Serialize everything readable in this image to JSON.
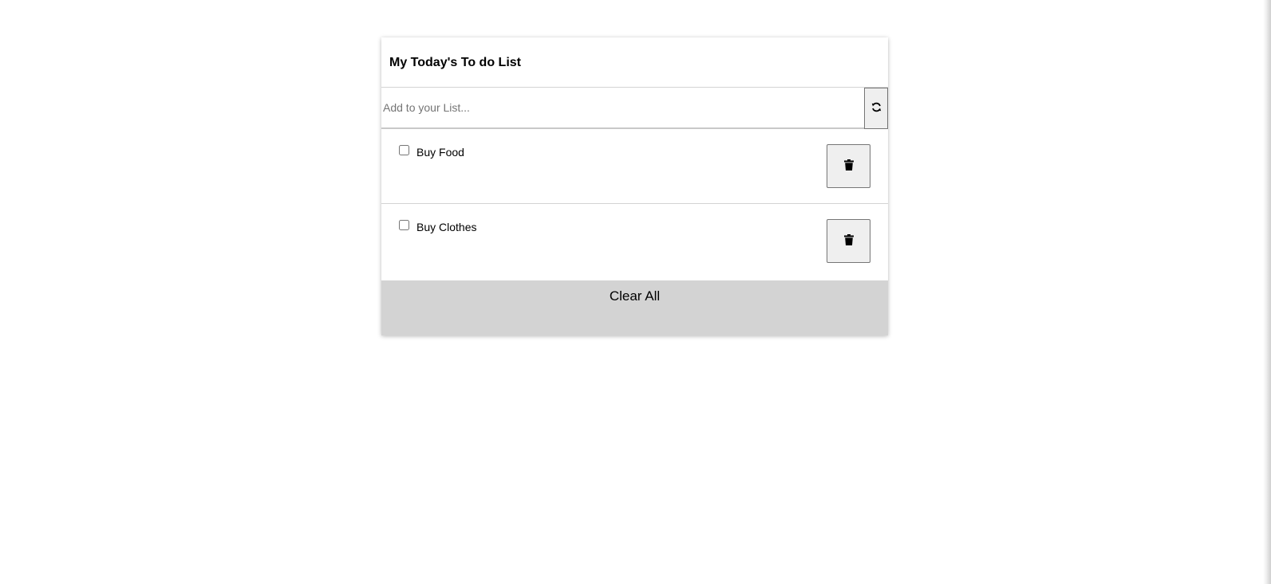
{
  "todo": {
    "title": "My Today's To do List",
    "input": {
      "value": "",
      "placeholder": "Add to your List..."
    },
    "refresh_icon": "refresh-icon",
    "items": [
      {
        "label": "Buy Food",
        "checked": false,
        "delete_icon": "trash-icon"
      },
      {
        "label": "Buy Clothes",
        "checked": false,
        "delete_icon": "trash-icon"
      }
    ],
    "clear_all_label": "Clear All"
  },
  "colors": {
    "clear_bar": "#d3d3d3",
    "button_bg": "#efefef",
    "divider": "#d3d3d3"
  }
}
